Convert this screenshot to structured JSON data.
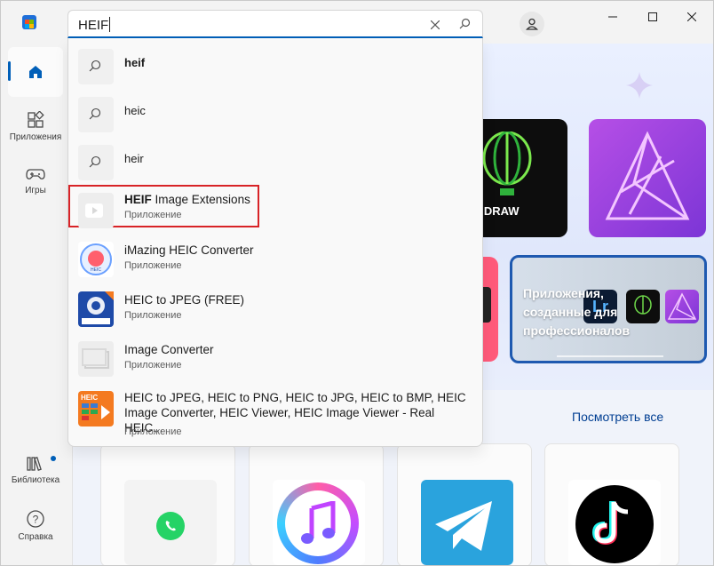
{
  "sidebar": {
    "items": [
      {
        "label": "",
        "icon": "home-icon"
      },
      {
        "label": "Приложения",
        "icon": "apps-icon"
      },
      {
        "label": "Игры",
        "icon": "gamepad-icon"
      },
      {
        "label": "Библиотека",
        "icon": "library-icon"
      },
      {
        "label": "Справка",
        "icon": "help-icon"
      }
    ]
  },
  "search": {
    "value": "HEIF",
    "suggestions": [
      {
        "text": "heif"
      },
      {
        "text": "heic"
      },
      {
        "text": "heir"
      }
    ],
    "results": [
      {
        "name_bold": "HEIF",
        "name_rest": " Image Extensions",
        "type": "Приложение"
      },
      {
        "name": "iMazing HEIC Converter",
        "type": "Приложение"
      },
      {
        "name": "HEIC to JPEG (FREE)",
        "type": "Приложение"
      },
      {
        "name": "Image Converter",
        "type": "Приложение"
      },
      {
        "name": "HEIC to JPEG, HEIC to PNG, HEIC to JPG, HEIC to BMP, HEIC Image Converter, HEIC Viewer, HEIC Image Viewer - Real HEIC...",
        "type": "Приложение"
      }
    ]
  },
  "hero": {
    "corel_text": "orelDRAW",
    "pro_text": "Приложения, созданные для профессионалов",
    "lr_text": "Lr"
  },
  "main": {
    "see_all": "Посмотреть все"
  },
  "colors": {
    "accent": "#005fb8",
    "highlight_border": "#d82327"
  }
}
